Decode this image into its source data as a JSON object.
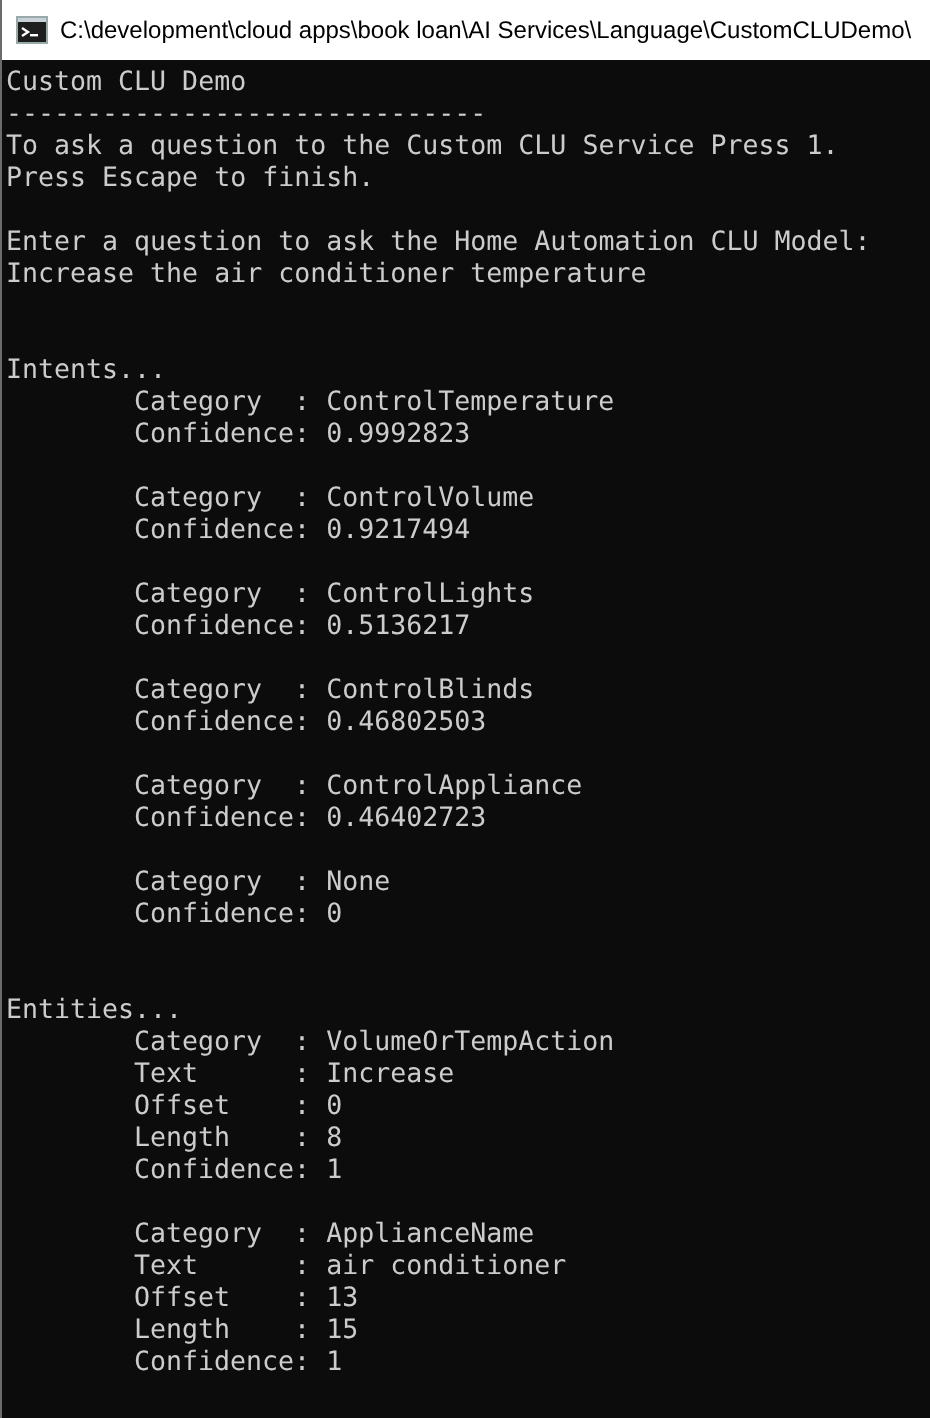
{
  "window": {
    "title": "C:\\development\\cloud apps\\book loan\\AI Services\\Language\\CustomCLUDemo\\"
  },
  "console": {
    "intro_lines": [
      "Custom CLU Demo",
      "------------------------------",
      "To ask a question to the Custom CLU Service Press 1.",
      "Press Escape to finish."
    ],
    "prompt_lines": [
      "Enter a question to ask the Home Automation CLU Model:",
      "Increase the air conditioner temperature"
    ],
    "sections": [
      {
        "heading": "Intents...",
        "records": [
          {
            "lines": [
              "Category  : ControlTemperature",
              "Confidence: 0.9992823"
            ]
          },
          {
            "lines": [
              "Category  : ControlVolume",
              "Confidence: 0.9217494"
            ]
          },
          {
            "lines": [
              "Category  : ControlLights",
              "Confidence: 0.5136217"
            ]
          },
          {
            "lines": [
              "Category  : ControlBlinds",
              "Confidence: 0.46802503"
            ]
          },
          {
            "lines": [
              "Category  : ControlAppliance",
              "Confidence: 0.46402723"
            ]
          },
          {
            "lines": [
              "Category  : None",
              "Confidence: 0"
            ]
          }
        ]
      },
      {
        "heading": "Entities...",
        "records": [
          {
            "lines": [
              "Category  : VolumeOrTempAction",
              "Text      : Increase",
              "Offset    : 0",
              "Length    : 8",
              "Confidence: 1"
            ]
          },
          {
            "lines": [
              "Category  : ApplianceName",
              "Text      : air conditioner",
              "Offset    : 13",
              "Length    : 15",
              "Confidence: 1"
            ]
          }
        ]
      }
    ]
  }
}
